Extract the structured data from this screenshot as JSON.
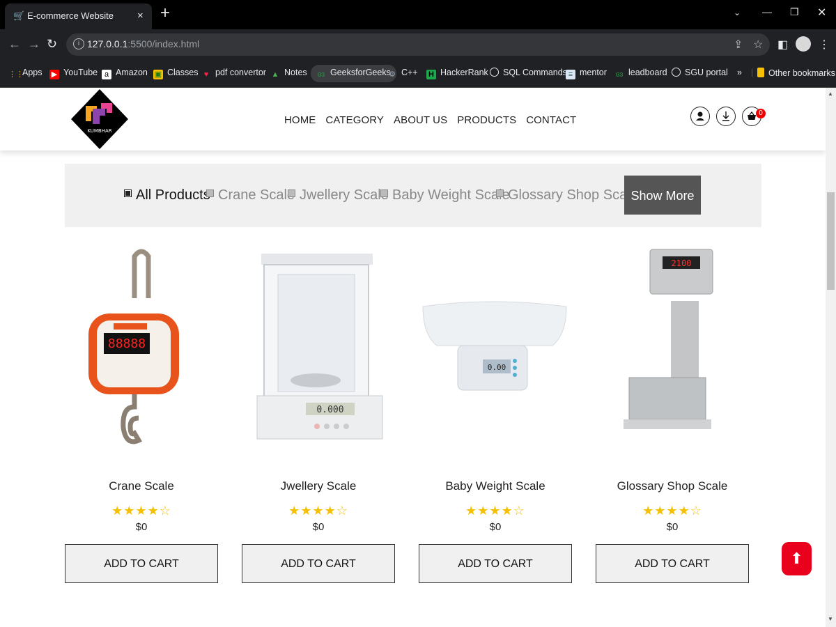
{
  "browser": {
    "tab_title": "E-commerce Website",
    "tab_close": "×",
    "new_tab": "+",
    "url_host": "127.0.0.1",
    "url_rest": ":5500/index.html",
    "bookmarks": [
      {
        "label": "Apps",
        "icon": "apps-grid-icon"
      },
      {
        "label": "YouTube",
        "icon": "youtube-icon"
      },
      {
        "label": "Amazon",
        "icon": "amazon-icon"
      },
      {
        "label": "Classes",
        "icon": "classes-icon"
      },
      {
        "label": "pdf convertor",
        "icon": "pdf-icon"
      },
      {
        "label": "Notes",
        "icon": "drive-icon"
      },
      {
        "label": "GeeksforGeeks",
        "icon": "gfg-icon"
      },
      {
        "label": "C++",
        "icon": "cpp-icon"
      },
      {
        "label": "HackerRank",
        "icon": "hackerrank-icon"
      },
      {
        "label": "SQL Commands",
        "icon": "globe-icon"
      },
      {
        "label": "mentor",
        "icon": "doc-icon"
      },
      {
        "label": "leadboard",
        "icon": "gfg-icon"
      },
      {
        "label": "SGU portal",
        "icon": "globe-icon"
      }
    ],
    "bookmarks_more": "»",
    "other_bookmarks": "Other bookmarks"
  },
  "header": {
    "logo_text": "KUMBHAR",
    "nav": [
      "HOME",
      "CATEGORY",
      "ABOUT US",
      "PRODUCTS",
      "CONTACT"
    ],
    "cart_count": "0"
  },
  "filters": {
    "items": [
      "All Products",
      "Crane Scale",
      "Jwellery Scale",
      "Baby Weight Scale",
      "Glossary Shop Scale"
    ],
    "active_index": 0,
    "show_more": "Show More ↓"
  },
  "products": [
    {
      "name": "Crane Scale",
      "stars": "★★★★☆",
      "rating": 4,
      "price": "$0",
      "button": "ADD TO CART"
    },
    {
      "name": "Jwellery Scale",
      "stars": "★★★★☆",
      "rating": 4,
      "price": "$0",
      "button": "ADD TO CART"
    },
    {
      "name": "Baby Weight Scale",
      "stars": "★★★★☆",
      "rating": 4,
      "price": "$0",
      "button": "ADD TO CART"
    },
    {
      "name": "Glossary Shop Scale",
      "stars": "★★★★☆",
      "rating": 4,
      "price": "$0",
      "button": "ADD TO CART"
    }
  ],
  "back_to_top": "⬆",
  "colors": {
    "accent_red": "#e8001c",
    "star_yellow": "#f5c000",
    "filter_bg": "#f0f0f0",
    "button_dark": "#555555"
  }
}
